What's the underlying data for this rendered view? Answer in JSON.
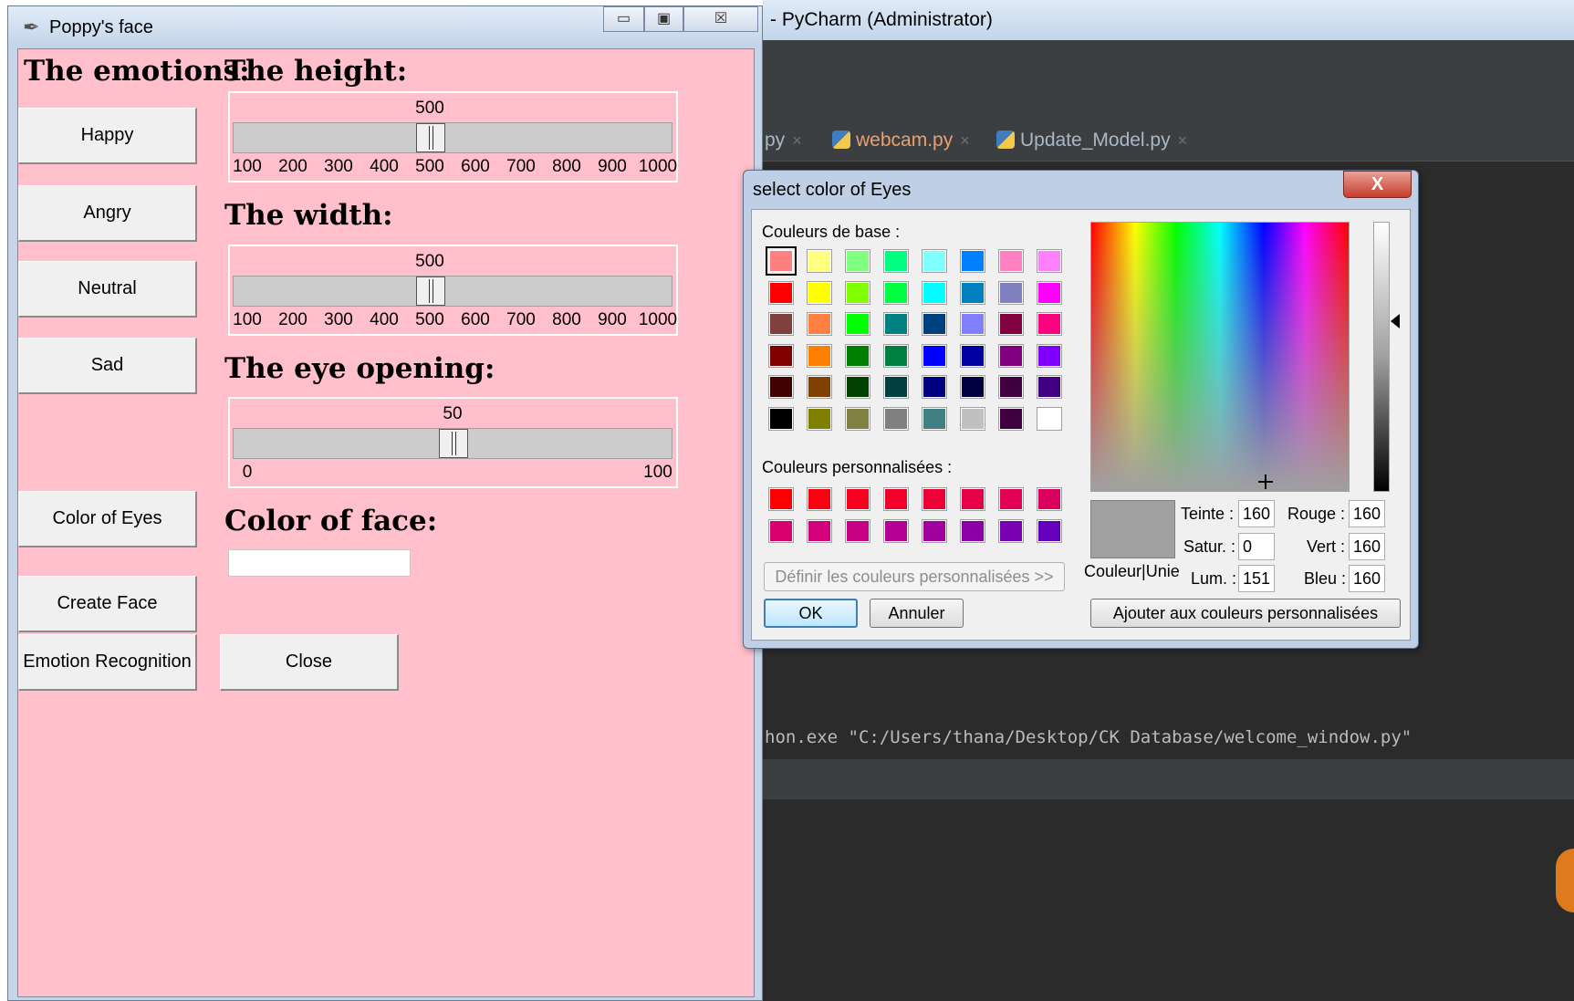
{
  "pycharm": {
    "title": "- PyCharm (Administrator)",
    "tabs": [
      {
        "label": "py"
      },
      {
        "label": "webcam.py"
      },
      {
        "label": "Update_Model.py"
      }
    ],
    "console_command": "hon.exe \"C:/Users/thana/Desktop/CK Database/welcome_window.py\"",
    "close_glyph": "×"
  },
  "tk_window": {
    "title": "Poppy's face",
    "controls": {
      "minimize": "▭",
      "maximize": "▣",
      "close": "☒"
    },
    "emotions_header": "The emotions:",
    "buttons": {
      "happy": "Happy",
      "angry": "Angry",
      "neutral": "Neutral",
      "sad": "Sad",
      "color_of_eyes": "Color of Eyes",
      "create_face": "Create Face",
      "emotion_recognition": "Emotion Recognition",
      "close": "Close"
    },
    "height_header": "The height:",
    "width_header": "The width:",
    "eye_header": "The eye opening:",
    "face_color_header": "Color of face:",
    "face_color_value": "",
    "height_scale": {
      "min": 100,
      "max": 1000,
      "value": 500,
      "value_label": "500",
      "ticks": [
        "100",
        "200",
        "300",
        "400",
        "500",
        "600",
        "700",
        "800",
        "900",
        "1000"
      ]
    },
    "width_scale": {
      "min": 100,
      "max": 1000,
      "value": 500,
      "value_label": "500",
      "ticks": [
        "100",
        "200",
        "300",
        "400",
        "500",
        "600",
        "700",
        "800",
        "900",
        "1000"
      ]
    },
    "eye_scale": {
      "min": 0,
      "max": 100,
      "value": 50,
      "value_label": "50",
      "ticks": [
        "0",
        "100"
      ]
    }
  },
  "color_dialog": {
    "title": "select color of Eyes",
    "close_glyph": "X",
    "base_colors_label": "Couleurs de base :",
    "custom_colors_label": "Couleurs personnalisées :",
    "base_colors": [
      "#ff8080",
      "#ffff80",
      "#80ff80",
      "#00ff80",
      "#80ffff",
      "#0080ff",
      "#ff80c0",
      "#ff80ff",
      "#ff0000",
      "#ffff00",
      "#80ff00",
      "#00ff40",
      "#00ffff",
      "#0080c0",
      "#8080c0",
      "#ff00ff",
      "#804040",
      "#ff8040",
      "#00ff00",
      "#008080",
      "#004080",
      "#8080ff",
      "#800040",
      "#ff0080",
      "#800000",
      "#ff8000",
      "#008000",
      "#008040",
      "#0000ff",
      "#0000a0",
      "#800080",
      "#8000ff",
      "#400000",
      "#804000",
      "#004000",
      "#004040",
      "#000080",
      "#000040",
      "#400040",
      "#400080",
      "#000000",
      "#808000",
      "#808040",
      "#808080",
      "#408080",
      "#c0c0c0",
      "#400040",
      "#ffffff"
    ],
    "custom_colors": [
      "#ff0000",
      "#fa0010",
      "#f5001e",
      "#f0002a",
      "#eb0038",
      "#e60046",
      "#e10052",
      "#dc005e",
      "#d7006c",
      "#d2007a",
      "#c80088",
      "#b40094",
      "#a0009e",
      "#8c00a8",
      "#7800b2",
      "#6400bc"
    ],
    "define_custom_button": "Définir les couleurs personnalisées >>",
    "ok_button": "OK",
    "cancel_button": "Annuler",
    "add_custom_button": "Ajouter aux couleurs personnalisées",
    "solid_color_label": "Couleur|Unie",
    "fields": {
      "hue": {
        "label": "Teinte :",
        "value": "160"
      },
      "sat": {
        "label": "Satur. :",
        "value": "0"
      },
      "lum": {
        "label": "Lum. :",
        "value": "151"
      },
      "red": {
        "label": "Rouge :",
        "value": "160"
      },
      "green": {
        "label": "Vert :",
        "value": "160"
      },
      "blue": {
        "label": "Bleu :",
        "value": "160"
      }
    },
    "current_color": "#a0a0a0"
  }
}
